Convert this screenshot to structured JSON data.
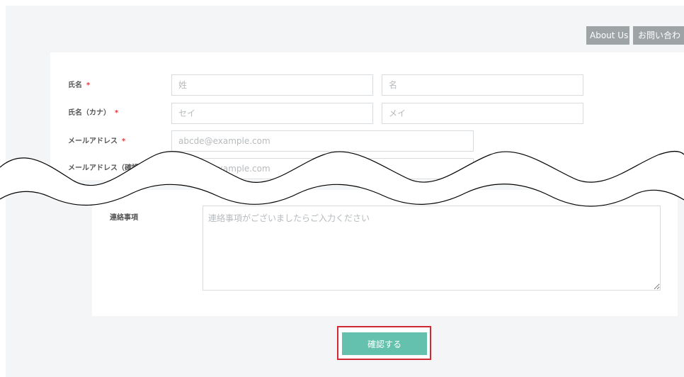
{
  "nav": {
    "about_label": "About Us",
    "contact_label": "お問い合わ"
  },
  "form": {
    "name": {
      "label": "氏名",
      "required_mark": "*",
      "last_placeholder": "姓",
      "first_placeholder": "名"
    },
    "name_kana": {
      "label": "氏名（カナ）",
      "required_mark": "*",
      "last_placeholder": "セイ",
      "first_placeholder": "メイ"
    },
    "email": {
      "label": "メールアドレス",
      "required_mark": "*",
      "placeholder": "abcde@example.com"
    },
    "email_confirm": {
      "label": "メールアドレス（確認）",
      "required_mark": "*",
      "placeholder": "abcde@example.com"
    },
    "message": {
      "label": "連絡事項",
      "placeholder": "連絡事項がございましたらご入力ください"
    },
    "submit_label": "確認する"
  },
  "colors": {
    "accent": "#64c1ad",
    "highlight": "#cf2a34",
    "required": "#e03c3c",
    "nav_button": "#9ea3a6"
  }
}
